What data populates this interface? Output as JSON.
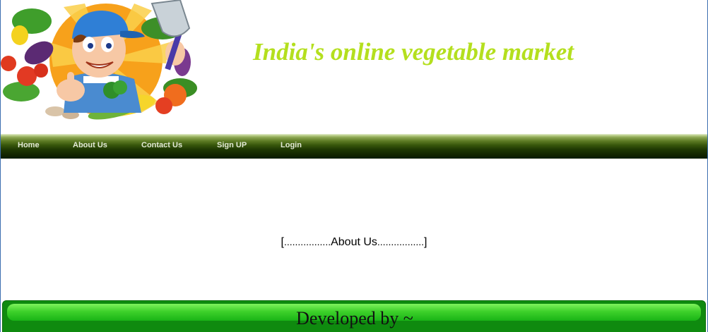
{
  "header": {
    "logo_alt": "cartoon farmer holding a shovel surrounded by vegetables",
    "tagline": "India's online vegetable market",
    "tagline_color": "#b4df1e"
  },
  "nav": {
    "items": [
      {
        "label": "Home"
      },
      {
        "label": "About Us"
      },
      {
        "label": "Contact Us"
      },
      {
        "label": "Sign UP"
      },
      {
        "label": "Login"
      }
    ]
  },
  "main": {
    "bracket_open": "[",
    "dots_left": ".................",
    "title": "About Us",
    "dots_right": ".................",
    "bracket_close": "]"
  },
  "footer": {
    "text": "Developed by ~",
    "color": "#19b416"
  }
}
